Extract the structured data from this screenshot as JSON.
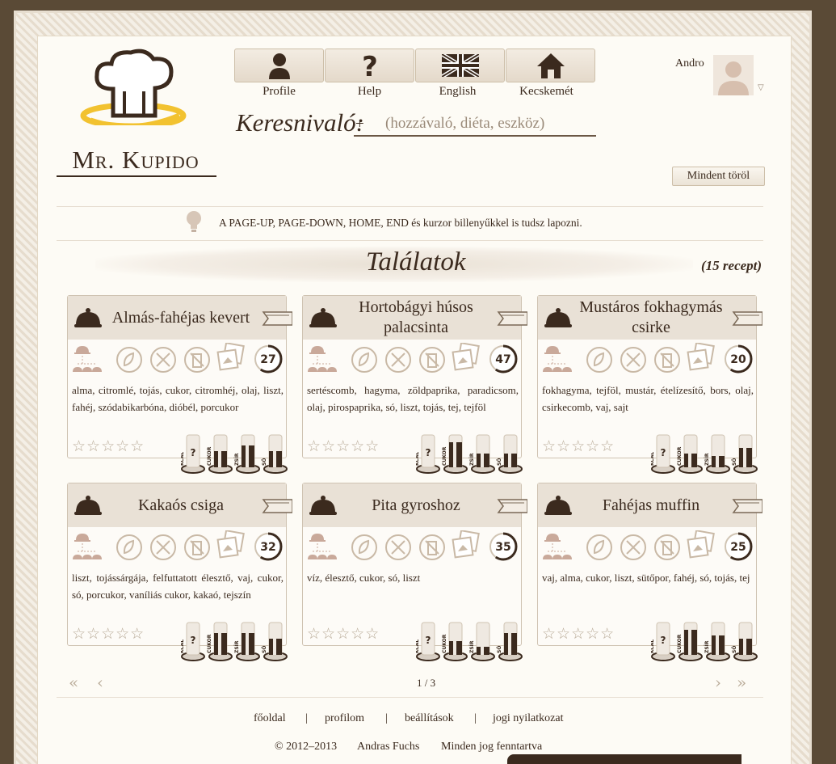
{
  "header": {
    "brand": "Mr. Kupido",
    "nav": [
      {
        "label": "Profile",
        "icon": "person-icon"
      },
      {
        "label": "Help",
        "icon": "question-icon"
      },
      {
        "label": "English",
        "icon": "uk-flag-icon"
      },
      {
        "label": "Kecskemét",
        "icon": "house-icon"
      }
    ],
    "search_label": "Keresnivaló:",
    "search_plus": "+",
    "search_placeholder": "(hozzávaló, diéta, eszköz)",
    "user_name": "Andro",
    "clear_all": "Mindent töröl"
  },
  "tip": "A PAGE-UP, PAGE-DOWN, HOME, END és kurzor billenyűkkel is tudsz lapozni.",
  "results": {
    "title": "Találatok",
    "count": "(15 recept)",
    "recipes": [
      {
        "title": "Almás-fahéjas kevert",
        "minutes": "27",
        "ingredients": "alma, citromlé, tojás, cukor, citromhéj, olaj, liszt, fahéj, szódabikarbóna, dióbél, porcukor",
        "rating": 0,
        "nutrition": {
          "kcal": "?",
          "cukor": 0.6,
          "zsir": 0.8,
          "so": 0.6
        }
      },
      {
        "title": "Hortobágyi húsos palacsinta",
        "minutes": "47",
        "ingredients": "sertéscomb, hagyma, zöldpaprika, paradicsom, olaj, pirospaprika, só, liszt, tojás, tej, tejföl",
        "rating": 0,
        "nutrition": {
          "kcal": "?",
          "cukor": 0.9,
          "zsir": 0.5,
          "so": 0.5
        }
      },
      {
        "title": "Mustáros fokhagymás csirke",
        "minutes": "20",
        "ingredients": "fokhagyma, tejföl, mustár, ételízesítő, bors, olaj, csirkecomb, vaj, sajt",
        "rating": 0,
        "nutrition": {
          "kcal": "?",
          "cukor": 0.5,
          "zsir": 0.4,
          "so": 0.7
        }
      },
      {
        "title": "Kakaós csiga",
        "minutes": "32",
        "ingredients": "liszt, tojássárgája, felfuttatott élesztő, vaj, cukor, só, porcukor, vaníliás cukor, kakaó, tejszín",
        "rating": 0,
        "nutrition": {
          "kcal": "?",
          "cukor": 0.8,
          "zsir": 0.8,
          "so": 0.6
        }
      },
      {
        "title": "Pita gyroshoz",
        "minutes": "35",
        "ingredients": "víz, élesztő, cukor, só, liszt",
        "rating": 0,
        "nutrition": {
          "kcal": "?",
          "cukor": 0.5,
          "zsir": 0.3,
          "so": 0.8
        }
      },
      {
        "title": "Fahéjas muffin",
        "minutes": "25",
        "ingredients": "vaj, alma, cukor, liszt, sütőpor, fahéj, só, tojás, tej",
        "rating": 0,
        "nutrition": {
          "kcal": "?",
          "cukor": 0.9,
          "zsir": 0.7,
          "so": 0.6
        }
      }
    ],
    "nutrition_labels": [
      "KCAL",
      "CUKOR",
      "ZSÍR",
      "SÓ"
    ]
  },
  "pager": {
    "text": "1 / 3"
  },
  "footer": {
    "links": [
      "főoldal",
      "profilom",
      "beállítások",
      "jogi nyilatkozat"
    ],
    "separator": "|",
    "copyright": "© 2012–2013",
    "author": "Andras Fuchs",
    "rights": "Minden jog fenntartva"
  },
  "colors": {
    "dark": "#3b2a1e",
    "band": "#e9e1d6",
    "accent_yellow": "#f2c230"
  }
}
